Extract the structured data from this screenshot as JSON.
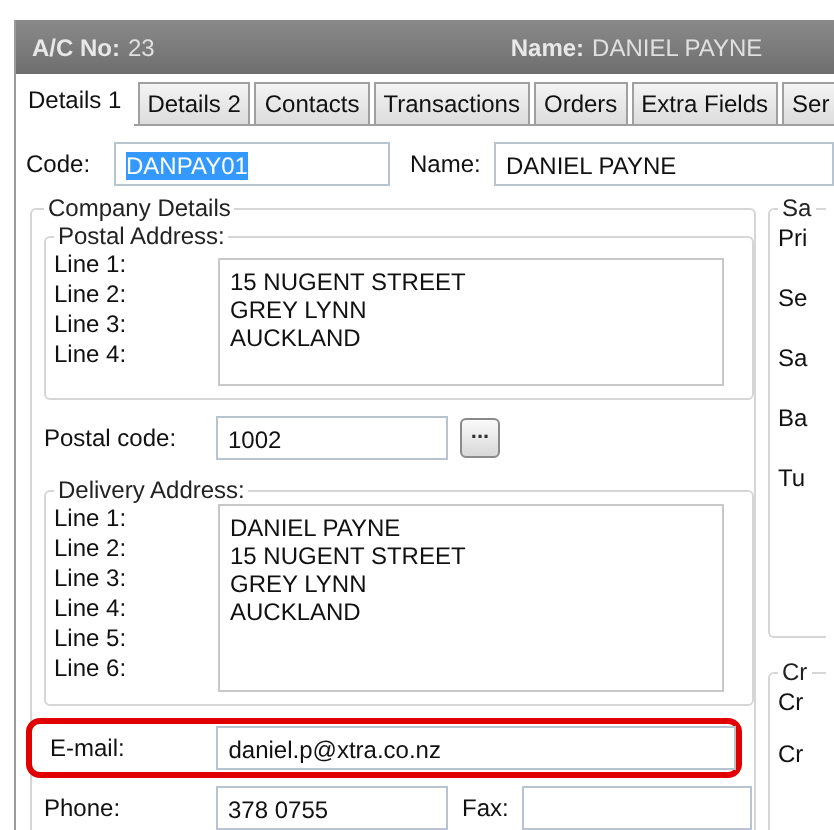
{
  "header": {
    "account_label": "A/C No:",
    "account_value": "23",
    "name_label": "Name:",
    "name_value": "DANIEL PAYNE"
  },
  "tabs": [
    {
      "label": "Details 1",
      "selected": true
    },
    {
      "label": "Details 2",
      "selected": false
    },
    {
      "label": "Contacts",
      "selected": false
    },
    {
      "label": "Transactions",
      "selected": false
    },
    {
      "label": "Orders",
      "selected": false
    },
    {
      "label": "Extra Fields",
      "selected": false
    },
    {
      "label": "Ser",
      "selected": false
    }
  ],
  "code": {
    "label": "Code:",
    "value": "DANPAY01",
    "text_selected": true
  },
  "name": {
    "label": "Name:",
    "value": "DANIEL PAYNE"
  },
  "company_details": {
    "title": "Company Details",
    "postal_address": {
      "title": "Postal Address:",
      "line_labels": [
        "Line 1:",
        "Line 2:",
        "Line 3:",
        "Line 4:"
      ],
      "lines": [
        "15 NUGENT STREET",
        "GREY LYNN",
        "AUCKLAND"
      ]
    },
    "postal_code": {
      "label": "Postal code:",
      "value": "1002",
      "button": "..."
    },
    "delivery_address": {
      "title": "Delivery Address:",
      "line_labels": [
        "Line 1:",
        "Line 2:",
        "Line 3:",
        "Line 4:",
        "Line 5:",
        "Line 6:"
      ],
      "lines": [
        "DANIEL PAYNE",
        "15 NUGENT STREET",
        "GREY LYNN",
        "AUCKLAND"
      ]
    },
    "email": {
      "label": "E-mail:",
      "value": "daniel.p@xtra.co.nz",
      "highlighted": true
    },
    "phone": {
      "label": "Phone:",
      "value": "378 0755"
    },
    "fax": {
      "label": "Fax:"
    }
  },
  "right_groups": [
    {
      "title": "Sa",
      "labels": [
        "Pri",
        "Se",
        "Sa",
        "Ba",
        "Tu"
      ]
    },
    {
      "title": "Cr",
      "labels": [
        "Cr",
        "Cr"
      ]
    }
  ]
}
